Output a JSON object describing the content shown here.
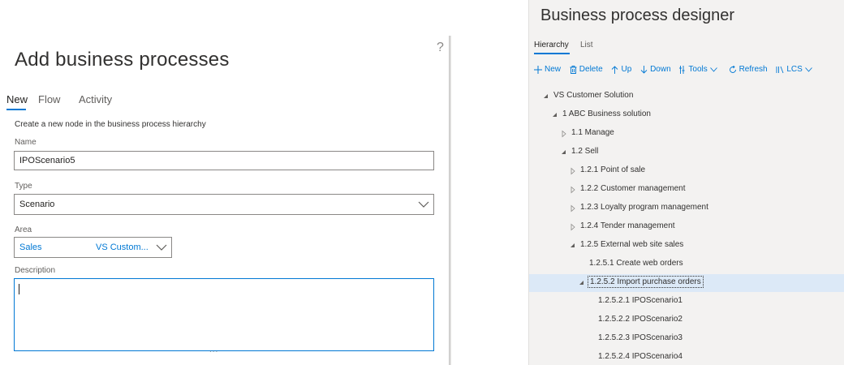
{
  "left_dialog": {
    "help": "?",
    "title": "Add business processes",
    "tabs": [
      {
        "label": "New"
      },
      {
        "label": "Flow"
      },
      {
        "label": "Activity"
      }
    ],
    "instruction": "Create a new node in the business process hierarchy",
    "name": {
      "label": "Name",
      "value": "IPOScenario5"
    },
    "type": {
      "label": "Type",
      "value": "Scenario"
    },
    "area": {
      "label": "Area",
      "value": "Sales",
      "secondary": "VS Custom..."
    },
    "description": {
      "label": "Description",
      "value": ""
    },
    "resize_handle": "..."
  },
  "designer": {
    "title": "Business process designer",
    "tabs": [
      {
        "label": "Hierarchy"
      },
      {
        "label": "List"
      }
    ],
    "toolbar": [
      {
        "label": "New",
        "icon": "plus-icon"
      },
      {
        "label": "Delete",
        "icon": "trash-icon"
      },
      {
        "label": "Up",
        "icon": "arrow-up-icon"
      },
      {
        "label": "Down",
        "icon": "arrow-down-icon"
      },
      {
        "label": "Tools",
        "icon": "tools-icon"
      },
      {
        "label": "Refresh",
        "icon": "refresh-icon"
      },
      {
        "label": "LCS",
        "icon": "lcs-icon"
      }
    ],
    "tree": [
      {
        "label": "VS Customer Solution",
        "state": "expanded"
      },
      {
        "label": "1 ABC Business solution",
        "state": "expanded"
      },
      {
        "label": "1.1 Manage",
        "state": "collapsed"
      },
      {
        "label": "1.2 Sell",
        "state": "expanded"
      },
      {
        "label": "1.2.1 Point of sale",
        "state": "collapsed"
      },
      {
        "label": "1.2.2 Customer management",
        "state": "collapsed"
      },
      {
        "label": "1.2.3 Loyalty program management",
        "state": "collapsed"
      },
      {
        "label": "1.2.4 Tender management",
        "state": "collapsed"
      },
      {
        "label": "1.2.5 External web site sales",
        "state": "expanded"
      },
      {
        "label": "1.2.5.1 Create web orders",
        "state": "leaf"
      },
      {
        "label": "1.2.5.2 Import purchase orders",
        "state": "expanded",
        "selected": true
      },
      {
        "label": "1.2.5.2.1 IPOScenario1",
        "state": "leaf"
      },
      {
        "label": "1.2.5.2.2 IPOScenario2",
        "state": "leaf"
      },
      {
        "label": "1.2.5.2.3 IPOScenario3",
        "state": "leaf"
      },
      {
        "label": "1.2.5.2.4 IPOScenario4",
        "state": "leaf"
      }
    ]
  },
  "colors": {
    "accent": "#0078d4",
    "selection": "#dce9f7",
    "panel_bg": "#f3f2f1"
  }
}
